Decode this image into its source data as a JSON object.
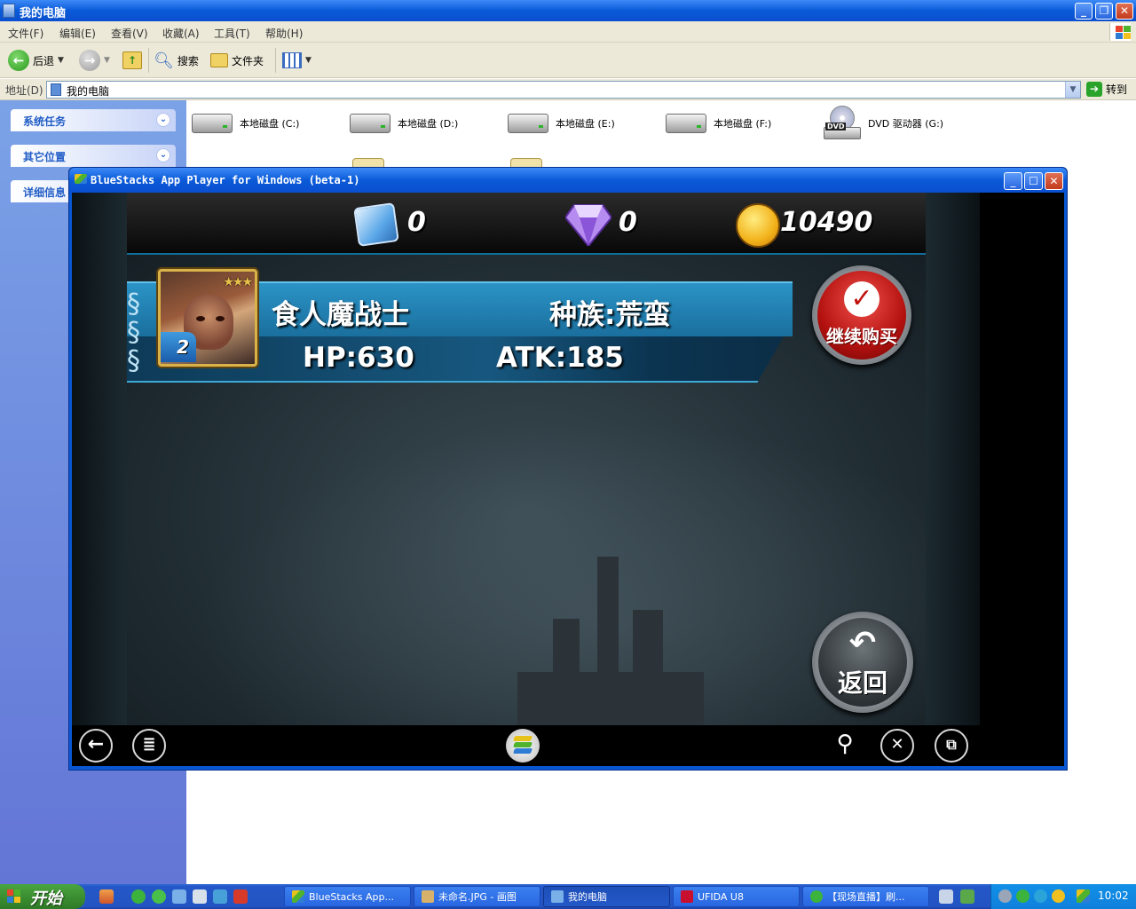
{
  "explorer": {
    "title": "我的电脑",
    "menu": [
      "文件(F)",
      "编辑(E)",
      "查看(V)",
      "收藏(A)",
      "工具(T)",
      "帮助(H)"
    ],
    "toolbar": {
      "back": "后退",
      "search": "搜索",
      "folders": "文件夹"
    },
    "address": {
      "label": "地址(D)",
      "value": "我的电脑",
      "go": "转到"
    },
    "tasks": [
      "系统任务",
      "其它位置",
      "详细信息"
    ],
    "drives": [
      "本地磁盘 (C:)",
      "本地磁盘 (D:)",
      "本地磁盘 (E:)",
      "本地磁盘 (F:)",
      "DVD 驱动器 (G:)"
    ],
    "dvd_tag": "DVD"
  },
  "bluestacks": {
    "title": "BlueStacks App Player for Windows (beta-1)",
    "currency": {
      "tickets": "0",
      "diamonds": "0",
      "gold": "10490"
    },
    "card": {
      "name": "食人魔战士",
      "race": "种族:荒蛮",
      "hp": "HP:630",
      "atk": "ATK:185",
      "stars": "★★★",
      "level": "2"
    },
    "buttons": {
      "continue_buy": "继续购买",
      "return": "返回"
    }
  },
  "taskbar": {
    "start": "开始",
    "tasks": [
      "BlueStacks App...",
      "未命名.JPG - 画图",
      "我的电脑",
      "UFIDA U8",
      "【现场直播】刷..."
    ],
    "clock": "10:02"
  }
}
